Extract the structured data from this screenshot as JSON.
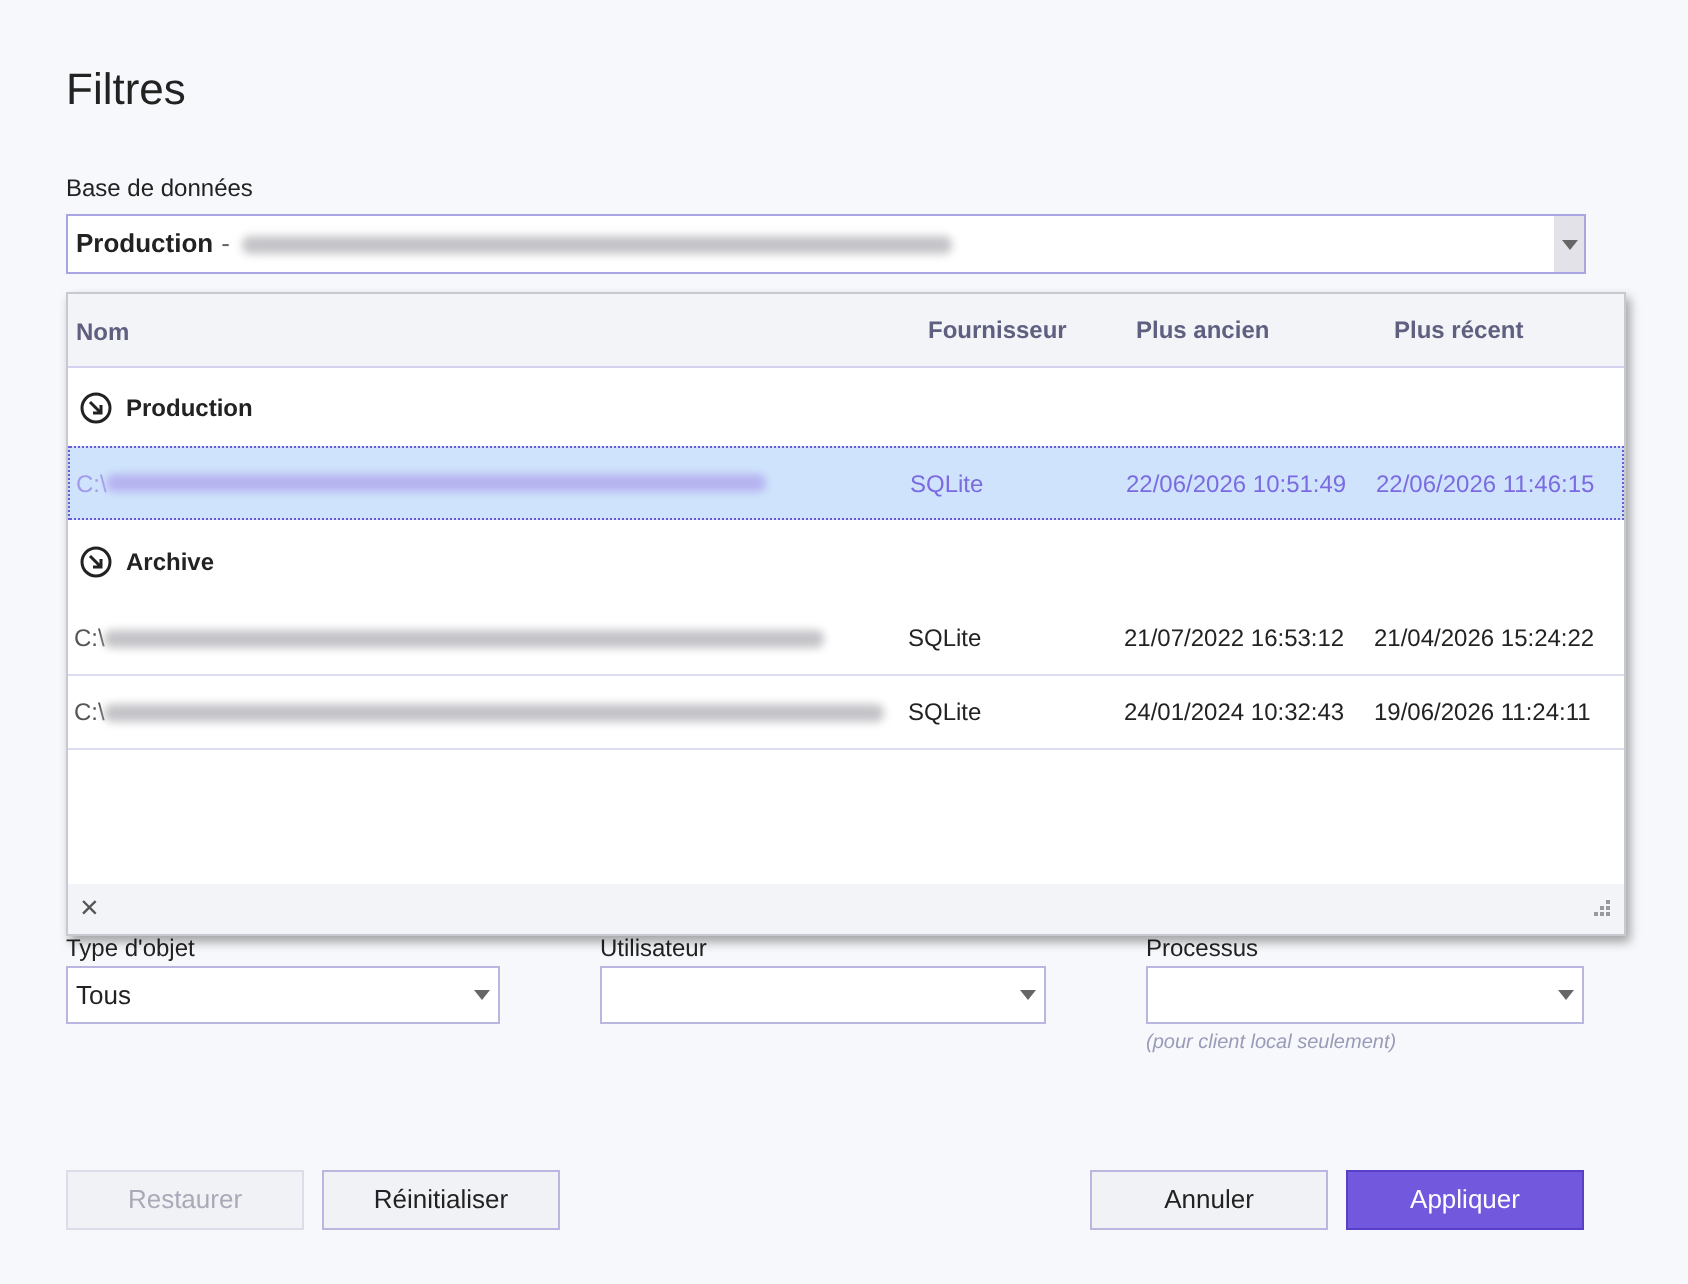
{
  "title": "Filtres",
  "database": {
    "label": "Base de données",
    "name": "Production",
    "separator": "-",
    "expanded": true
  },
  "dropdown": {
    "columns": [
      "Nom",
      "Fournisseur",
      "Plus ancien",
      "Plus récent"
    ],
    "groups": [
      {
        "name": "Production",
        "rows": [
          {
            "path": "C:\\",
            "provider": "SQLite",
            "oldest": "22/06/2026 10:51:49",
            "newest": "22/06/2026 11:46:15",
            "selected": true
          }
        ]
      },
      {
        "name": "Archive",
        "rows": [
          {
            "path": "C:\\",
            "provider": "SQLite",
            "oldest": "21/07/2022 16:53:12",
            "newest": "21/04/2026 15:24:22",
            "selected": false
          },
          {
            "path": "C:\\",
            "provider": "SQLite",
            "oldest": "24/01/2024 10:32:43",
            "newest": "19/06/2026 11:24:11",
            "selected": false
          }
        ]
      }
    ],
    "close": "×"
  },
  "filters": [
    {
      "label": "Type d'objet",
      "value": "Tous"
    },
    {
      "label": "Utilisateur"
    },
    {
      "label": "Processus",
      "hint": "(pour client local seulement)"
    }
  ],
  "buttons": [
    {
      "label": "Restaurer",
      "disabled": true,
      "primary": false
    },
    {
      "label": "Réinitialiser",
      "disabled": false,
      "primary": false
    },
    {
      "label": "Annuler",
      "disabled": false,
      "primary": false
    },
    {
      "label": "Appliquer",
      "disabled": false,
      "primary": true
    }
  ]
}
